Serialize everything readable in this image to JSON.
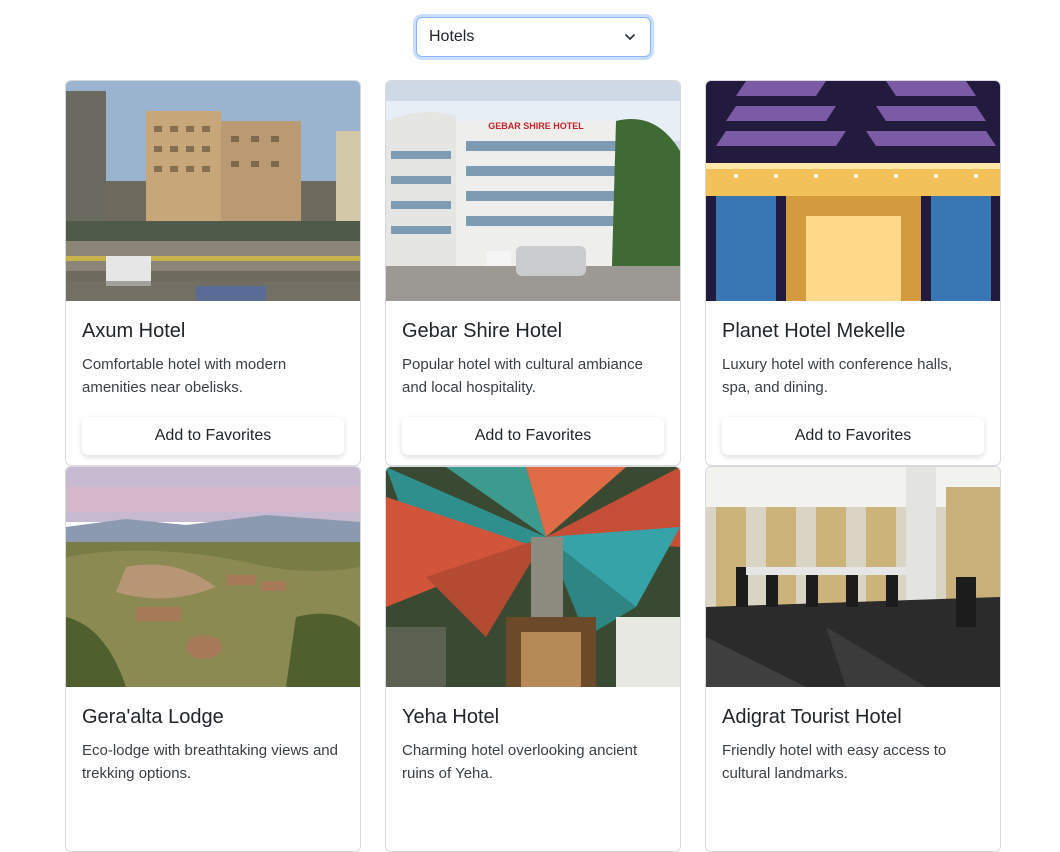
{
  "filter": {
    "selected": "Hotels",
    "icon": "chevron-down-icon"
  },
  "cards": [
    {
      "title": "Axum Hotel",
      "description": "Comfortable hotel with modern amenities near obelisks.",
      "button": "Add to Favorites"
    },
    {
      "title": "Gebar Shire Hotel",
      "description": "Popular hotel with cultural ambiance and local hospitality.",
      "button": "Add to Favorites",
      "sign": "GEBAR SHIRE HOTEL"
    },
    {
      "title": "Planet Hotel Mekelle",
      "description": "Luxury hotel with conference halls, spa, and dining.",
      "button": "Add to Favorites"
    },
    {
      "title": "Gera'alta Lodge",
      "description": "Eco-lodge with breathtaking views and trekking options."
    },
    {
      "title": "Yeha Hotel",
      "description": "Charming hotel overlooking ancient ruins of Yeha."
    },
    {
      "title": "Adigrat Tourist Hotel",
      "description": "Friendly hotel with easy access to cultural landmarks."
    }
  ],
  "colors": {
    "focus_border": "#86b7fe",
    "card_border": "#d7d9dc",
    "text": "#212529"
  }
}
